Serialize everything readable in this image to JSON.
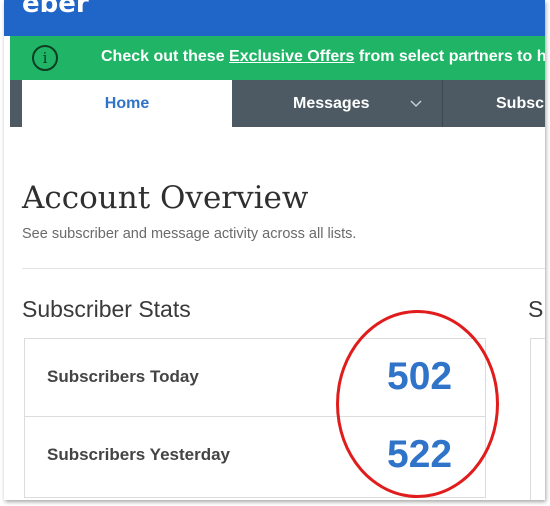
{
  "brand": {
    "logo_text": "eber"
  },
  "promo": {
    "prefix": "Check out these ",
    "link_text": "Exclusive Offers",
    "suffix": " from select partners to h"
  },
  "nav": {
    "tabs": [
      {
        "label": "Home",
        "active": true
      },
      {
        "label": "Messages",
        "has_dropdown": true
      },
      {
        "label": "Subsc"
      }
    ]
  },
  "page": {
    "title": "Account Overview",
    "subtitle": "See subscriber and message activity across all lists."
  },
  "subscriber_stats": {
    "title": "Subscriber Stats",
    "rows": [
      {
        "label": "Subscribers Today",
        "value": "502"
      },
      {
        "label": "Subscribers Yesterday",
        "value": "522"
      }
    ]
  },
  "right_section": {
    "title_fragment": "S"
  },
  "colors": {
    "brand_blue": "#1f66c8",
    "promo_green": "#1fb466",
    "nav_gray": "#4d5a63",
    "stat_blue": "#2f74c8",
    "annotation_red": "#e11c1c"
  }
}
